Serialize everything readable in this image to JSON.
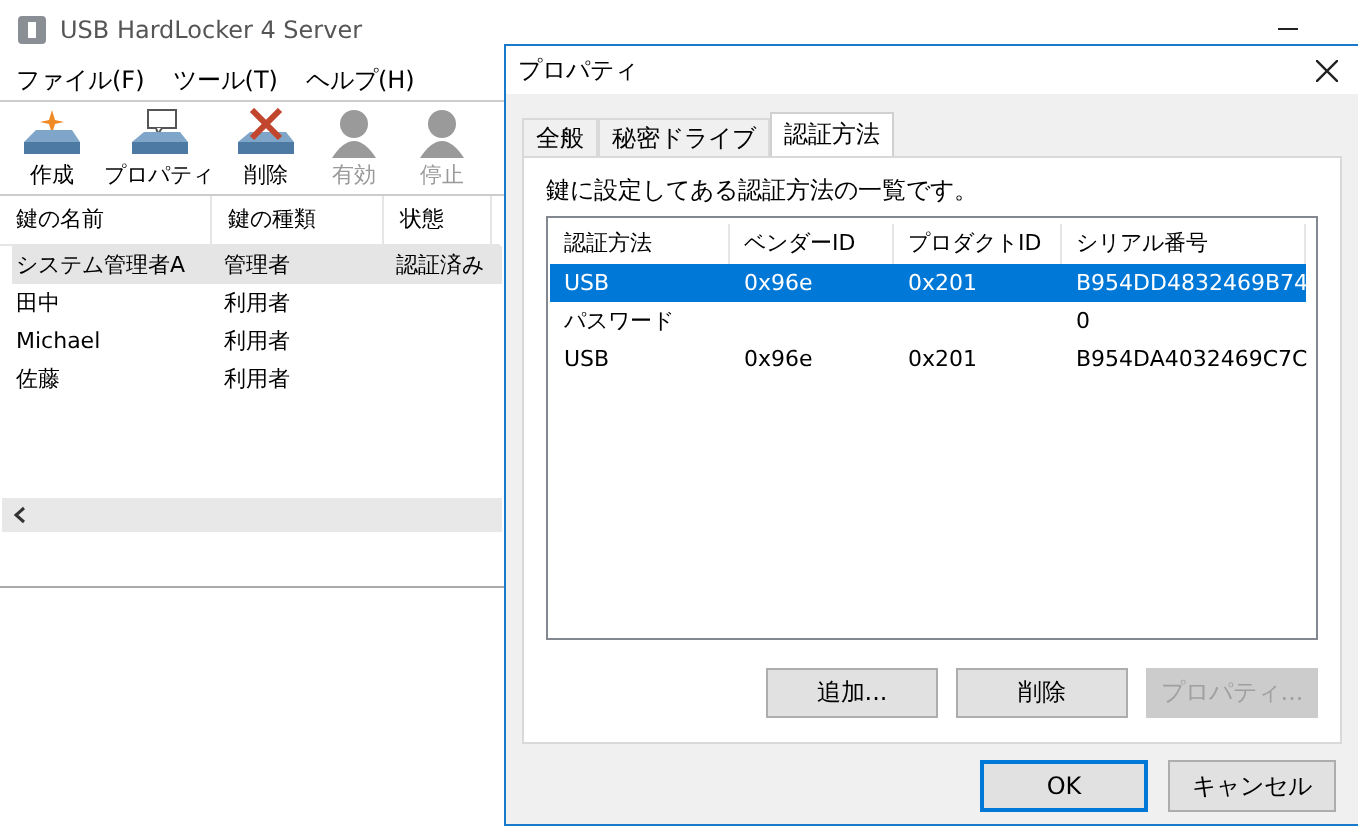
{
  "window": {
    "title": "USB HardLocker 4 Server"
  },
  "menu": [
    "ファイル(F)",
    "ツール(T)",
    "ヘルプ(H)"
  ],
  "toolbar": [
    {
      "label": "作成",
      "kind": "create",
      "disabled": false
    },
    {
      "label": "プロパティ",
      "kind": "properties",
      "disabled": false
    },
    {
      "label": "削除",
      "kind": "delete",
      "disabled": false
    },
    {
      "label": "有効",
      "kind": "user",
      "disabled": true
    },
    {
      "label": "停止",
      "kind": "user",
      "disabled": true
    }
  ],
  "keys": {
    "columns": [
      "鍵の名前",
      "鍵の種類",
      "状態"
    ],
    "rows": [
      {
        "cells": [
          "システム管理者A",
          "管理者",
          "認証済み"
        ],
        "selected": true
      },
      {
        "cells": [
          "田中",
          "利用者"
        ],
        "selected": false
      },
      {
        "cells": [
          "Michael",
          "利用者"
        ],
        "selected": false
      },
      {
        "cells": [
          "佐藤",
          "利用者"
        ],
        "selected": false
      }
    ]
  },
  "dialog": {
    "title": "プロパティ",
    "tabs": [
      {
        "label": "全般",
        "selected": false
      },
      {
        "label": "秘密ドライブ",
        "selected": false
      },
      {
        "label": "認証方法",
        "selected": true
      }
    ],
    "description": "鍵に設定してある認証方法の一覧です。",
    "columns": [
      "認証方法",
      "ベンダーID",
      "プロダクトID",
      "シリアル番号"
    ],
    "rows": [
      {
        "cells": [
          "USB",
          "0x96e",
          "0x201",
          "B954DD4832469B74"
        ],
        "selected": true
      },
      {
        "cells": [
          "パスワード",
          "",
          "",
          "0"
        ],
        "selected": false
      },
      {
        "cells": [
          "USB",
          "0x96e",
          "0x201",
          "B954DA4032469C7C"
        ],
        "selected": false
      }
    ],
    "list_buttons": [
      {
        "label": "追加...",
        "disabled": false
      },
      {
        "label": "削除",
        "disabled": false
      },
      {
        "label": "プロパティ...",
        "disabled": true
      }
    ],
    "buttons": [
      {
        "label": "OK",
        "default": true
      },
      {
        "label": "キャンセル",
        "default": false
      }
    ]
  }
}
